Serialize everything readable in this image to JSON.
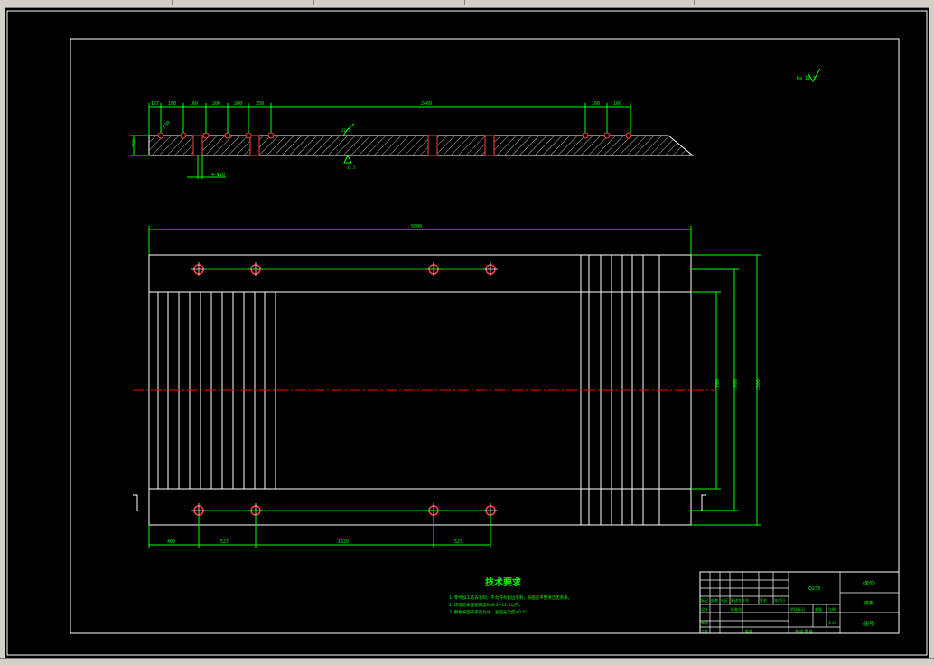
{
  "colors": {
    "frame": "#ffffff",
    "geometry": "#ffffff",
    "dimension": "#00ff00",
    "centerline": "#ff0000",
    "hole": "#ff4040",
    "hatch": "#ffffff",
    "title_text": "#00ff00"
  },
  "icons": {
    "surface_finish": "surface-roughness-symbol",
    "hole_mark": "circle-with-cross"
  },
  "side_view": {
    "top_dims": [
      "127",
      "160",
      "160",
      "200",
      "200",
      "250",
      "2460",
      "160",
      "160"
    ],
    "height_dim": "350",
    "hole_note": "4-Φ10",
    "angle_note": "R30",
    "roughness_top": "12.5",
    "roughness_bottom": "12.5"
  },
  "plan_view": {
    "overall_width": "5000",
    "right_dims": [
      "1700",
      "1990",
      "2300"
    ],
    "bottom_dims": [
      "400",
      "527",
      "1620",
      "527"
    ]
  },
  "roughness_corner": "Ra 12.5",
  "tech_requirements": {
    "title": "技术要求",
    "items": [
      "1. 零件加工后去毛刺，不允许有锐边毛刺，表面应平整清洁无杂质。",
      "2. 焊接后表面粗糙度Ra6.3~12.5以内。",
      "3. 钢板表面不平度允许，表面光洁度≤0.5°。"
    ]
  },
  "title_block": {
    "part_name": "底板",
    "org": "(单位)",
    "drawing_no": "(图号)",
    "material": "Q235",
    "scale": "1:10",
    "sheet": "共 张 第 张",
    "labels": [
      "标记",
      "处数",
      "分区",
      "更改文件号",
      "签名",
      "年月日"
    ],
    "row2": [
      "设计",
      "标准化",
      "阶段标记",
      "重量",
      "比例"
    ],
    "row3": [
      "审核",
      "工艺",
      "批准"
    ]
  }
}
